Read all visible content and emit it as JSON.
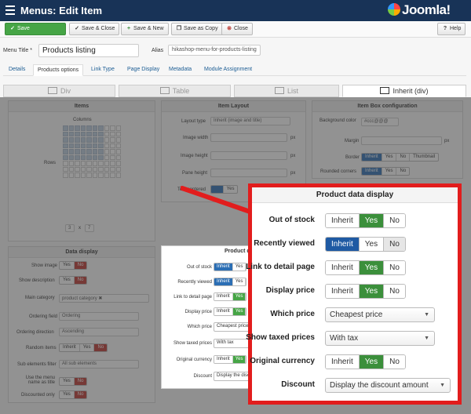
{
  "header": {
    "title": "Menus: Edit Item",
    "logo": "Joomla!"
  },
  "toolbar": {
    "save": "Save",
    "save_close": "Save & Close",
    "save_new": "Save & New",
    "save_copy": "Save as Copy",
    "close": "Close",
    "help": "Help"
  },
  "form": {
    "menu_title_label": "Menu Title *",
    "menu_title_value": "Products listing",
    "alias_label": "Alias",
    "alias_value": "hikashop-menu-for-products-listing"
  },
  "tabs": [
    "Details",
    "Products options",
    "Link Type",
    "Page Display",
    "Metadata",
    "Module Assignment"
  ],
  "view_tabs": [
    "Div",
    "Table",
    "List",
    "Inherit (div)"
  ],
  "items_panel": {
    "title": "Items",
    "columns_label": "Columns",
    "rows_label": "Rows",
    "rows_value": "3",
    "cols_value": "7",
    "x": "x"
  },
  "layout_panel": {
    "title": "Item Layout",
    "layout_type_label": "Layout type",
    "layout_type_value": "Inherit (image and title)",
    "image_width_label": "Image width",
    "image_height_label": "Image height",
    "pane_height_label": "Pane height",
    "text_centered_label": "Text centered",
    "px": "px",
    "yes": "Yes"
  },
  "box_panel": {
    "title": "Item Box configuration",
    "bg_color_label": "Background color",
    "bg_color_value": "#ccc@@@",
    "margin_label": "Margin",
    "border_label": "Border",
    "rounded_label": "Rounded corners",
    "inherit": "Inherit",
    "yes": "Yes",
    "no": "No",
    "thumbnail": "Thumbnail",
    "px": "px"
  },
  "data_display": {
    "title": "Data display",
    "show_image": "Show image",
    "show_description": "Show description",
    "main_category": "Main category",
    "main_category_value": "product category ✖",
    "ordering_field": "Ordering field",
    "ordering_value": "Ordering",
    "ordering_direction": "Ordering direction",
    "direction_value": "Ascending",
    "random_items": "Random items",
    "sub_elements_filter": "Sub elements filter",
    "sub_value": "All sub elements",
    "use_menu_name": "Use the menu name as title",
    "discounted_only": "Discounted only",
    "inherit": "Inherit",
    "yes": "Yes",
    "no": "No"
  },
  "small_panel": {
    "title": "Product d",
    "out_of_stock": "Out of stock",
    "recently_viewed": "Recently viewed",
    "link_to_detail": "Link to detail page",
    "display_price": "Display price",
    "which_price": "Which price",
    "which_price_value": "Cheapest price",
    "show_taxed": "Show taxed prices",
    "taxed_value": "With tax",
    "original_currency": "Original currency",
    "discount": "Discount",
    "discount_value": "Display the disco",
    "inherit": "Inherit",
    "yes": "Yes",
    "no": "No"
  },
  "callout": {
    "title": "Product data display",
    "rows": [
      {
        "label": "Out of stock",
        "type": "toggle",
        "options": [
          "Inherit",
          "Yes",
          "No"
        ]
      },
      {
        "label": "Recently viewed",
        "type": "toggle",
        "options": [
          "Inherit",
          "Yes",
          "No"
        ]
      },
      {
        "label": "Link to detail page",
        "type": "toggle",
        "options": [
          "Inherit",
          "Yes",
          "No"
        ]
      },
      {
        "label": "Display price",
        "type": "toggle",
        "options": [
          "Inherit",
          "Yes",
          "No"
        ]
      },
      {
        "label": "Which price",
        "type": "select",
        "value": "Cheapest price"
      },
      {
        "label": "Show taxed prices",
        "type": "select",
        "value": "With tax"
      },
      {
        "label": "Original currency",
        "type": "toggle",
        "options": [
          "Inherit",
          "Yes",
          "No"
        ]
      },
      {
        "label": "Discount",
        "type": "select",
        "value": "Display the discount amount"
      }
    ]
  },
  "colors": {
    "topbar": "#183357",
    "accent_blue": "#1f5aa3",
    "accent_green": "#3b8f3b",
    "accent_red": "#bd362f",
    "callout_border": "#e21d1d"
  }
}
